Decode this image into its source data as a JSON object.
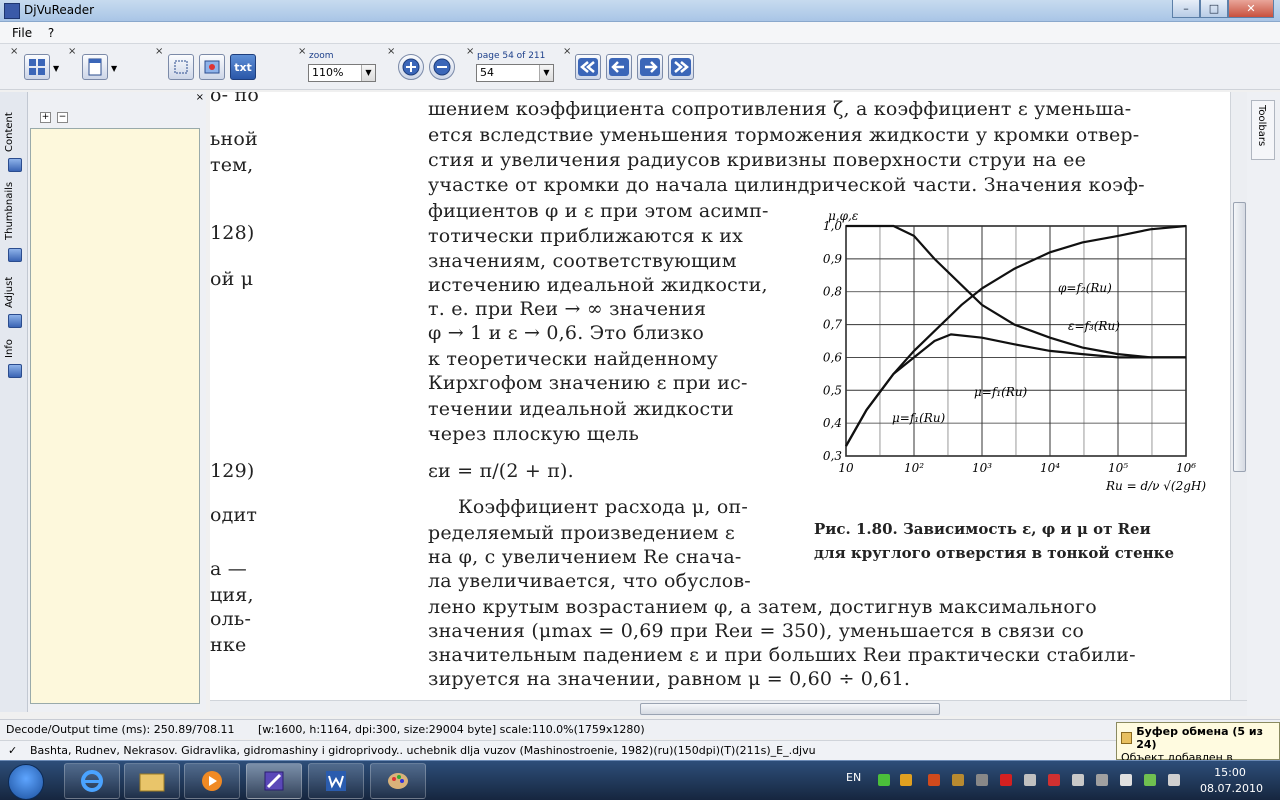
{
  "window": {
    "title": "DjVuReader",
    "minimize": "–",
    "maximize": "□",
    "close": "✕"
  },
  "menu": {
    "file": "File",
    "help": "?"
  },
  "toolbar": {
    "close_mark": "×",
    "txt_label": "txt",
    "zoom_label": "zoom",
    "zoom_value": "110%",
    "page_label": "page 54 of 211",
    "page_value": "54"
  },
  "sidebar": {
    "tabs": [
      {
        "label": "Content"
      },
      {
        "label": "Thumbnails"
      },
      {
        "label": "Adjust"
      },
      {
        "label": "Info"
      }
    ],
    "expand": "+",
    "collapse": "−",
    "right_tab": "Toolbars"
  },
  "document": {
    "left_margin": [
      "о- по",
      "ьной",
      "тем,",
      "128)",
      "ой μ",
      "129)",
      "одит",
      "а —",
      "ция,",
      "оль-",
      "нке"
    ],
    "top_lines": [
      "шением коэффициента сопротивления ζ, а коэффициент ε уменьша-",
      "ется вследствие уменьшения торможения жидкости у кромки отвер-",
      "стия и увеличения радиусов кривизны поверхности струи на ее",
      "участке от кромки до начала цилиндрической части. Значения коэф-"
    ],
    "column_lines": [
      "фициентов φ и ε при этом асимп-",
      "тотически приближаются к их",
      "значениям, соответствующим",
      "истечению идеальной жидкости,",
      "т. е. при Reи → ∞ значения",
      "φ → 1 и ε → 0,6. Это близко",
      "к теоретически найденному",
      "Кирхгофом значению ε при ис-",
      "течении идеальной жидкости",
      "через плоскую щель"
    ],
    "formula": "εи = π/(2 + π).",
    "para2_column": [
      "Коэффициент расхода μ, оп-",
      "ределяемый произведением ε",
      "на φ, с увеличением Re снача-",
      "ла увеличивается, что обуслов-"
    ],
    "para2_full": [
      "лено крутым возрастанием φ, а затем, достигнув максимального",
      "значения (μmax = 0,69 при Reи = 350), уменьшается в связи со",
      "значительным падением ε и при больших Reи практически стабили-",
      "зируется на значении, равном μ = 0,60 ÷ 0,61."
    ],
    "caption": [
      "Рис. 1.80. Зависимость ε, φ и μ от Reи",
      "для круглого отверстия в тонкой стенке"
    ]
  },
  "chart_data": {
    "type": "line",
    "title": "",
    "ylabel": "μ,φ,ε",
    "xlabel": "Rи = d/ν √(2gH)",
    "x_scale": "log",
    "xlim": [
      10,
      1000000
    ],
    "ylim": [
      0.3,
      1.0
    ],
    "x_ticks": [
      "10",
      "10²",
      "10³",
      "10⁴",
      "10⁵",
      "10⁶"
    ],
    "y_ticks": [
      "0,3",
      "0,4",
      "0,5",
      "0,6",
      "0,7",
      "0,8",
      "0,9",
      "1,0"
    ],
    "grid": true,
    "series": [
      {
        "name": "φ=f₂(Rи)",
        "x": [
          10,
          20,
          50,
          100,
          200,
          500,
          1000,
          3000,
          10000,
          30000,
          100000,
          300000,
          1000000
        ],
        "y": [
          0.33,
          0.44,
          0.55,
          0.62,
          0.68,
          0.76,
          0.81,
          0.87,
          0.92,
          0.95,
          0.97,
          0.99,
          1.0
        ]
      },
      {
        "name": "ε=f₃(Rи)",
        "x": [
          10,
          50,
          100,
          200,
          500,
          1000,
          3000,
          10000,
          30000,
          100000,
          300000,
          1000000
        ],
        "y": [
          1.0,
          1.0,
          0.97,
          0.9,
          0.82,
          0.76,
          0.7,
          0.66,
          0.63,
          0.61,
          0.6,
          0.6
        ]
      },
      {
        "name": "μ=f₁(Rи)",
        "x": [
          10,
          20,
          50,
          100,
          200,
          350,
          1000,
          3000,
          10000,
          30000,
          100000,
          300000,
          1000000
        ],
        "y": [
          0.33,
          0.44,
          0.55,
          0.6,
          0.65,
          0.67,
          0.66,
          0.64,
          0.62,
          0.61,
          0.6,
          0.6,
          0.6
        ]
      }
    ]
  },
  "status": {
    "decode": "Decode/Output time (ms): 250.89/708.11",
    "info": "[w:1600, h:1164, dpi:300, size:29004 byte] scale:110.0%(1759x1280)",
    "file": "Bashta, Rudnev, Nekrasov. Gidravlika, gidromashiny i gidroprivody.. uchebnik dlja vuzov (Mashinostroenie, 1982)(ru)(150dpi)(T)(211s)_E_.djvu"
  },
  "notification": {
    "title": "Буфер обмена (5 из 24)",
    "text": "Объект добавлен в буфер."
  },
  "taskbar": {
    "lang": "EN",
    "time": "15:00",
    "date": "08.07.2010"
  },
  "colors": {
    "accent": "#2a57a8",
    "panel_bg": "#fdf8dc",
    "taskbar": "#1e3456"
  }
}
